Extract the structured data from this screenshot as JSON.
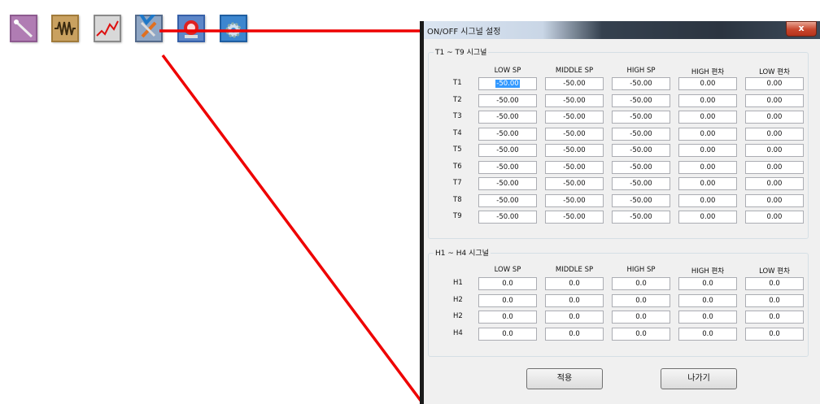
{
  "toolbar": {
    "icons": [
      "wand-icon",
      "resistor-icon",
      "graph-icon",
      "tools-check-icon",
      "alarm-icon",
      "gear-settings-icon"
    ]
  },
  "dialog": {
    "title": "ON/OFF 시그널 설정",
    "close_label": "x",
    "t_group": {
      "label": "T1 ~ T9 시그널",
      "headers": [
        "LOW SP",
        "MIDDLE SP",
        "HIGH SP",
        "HIGH 편차",
        "LOW 편차"
      ],
      "rows": [
        {
          "label": "T1",
          "values": [
            "-50.00",
            "-50.00",
            "-50.00",
            "0.00",
            "0.00"
          ]
        },
        {
          "label": "T2",
          "values": [
            "-50.00",
            "-50.00",
            "-50.00",
            "0.00",
            "0.00"
          ]
        },
        {
          "label": "T3",
          "values": [
            "-50.00",
            "-50.00",
            "-50.00",
            "0.00",
            "0.00"
          ]
        },
        {
          "label": "T4",
          "values": [
            "-50.00",
            "-50.00",
            "-50.00",
            "0.00",
            "0.00"
          ]
        },
        {
          "label": "T5",
          "values": [
            "-50.00",
            "-50.00",
            "-50.00",
            "0.00",
            "0.00"
          ]
        },
        {
          "label": "T6",
          "values": [
            "-50.00",
            "-50.00",
            "-50.00",
            "0.00",
            "0.00"
          ]
        },
        {
          "label": "T7",
          "values": [
            "-50.00",
            "-50.00",
            "-50.00",
            "0.00",
            "0.00"
          ]
        },
        {
          "label": "T8",
          "values": [
            "-50.00",
            "-50.00",
            "-50.00",
            "0.00",
            "0.00"
          ]
        },
        {
          "label": "T9",
          "values": [
            "-50.00",
            "-50.00",
            "-50.00",
            "0.00",
            "0.00"
          ]
        }
      ]
    },
    "h_group": {
      "label": "H1 ~ H4 시그널",
      "headers": [
        "LOW SP",
        "MIDDLE SP",
        "HIGH SP",
        "HIGH 편차",
        "LOW 편차"
      ],
      "rows": [
        {
          "label": "H1",
          "values": [
            "0.0",
            "0.0",
            "0.0",
            "0.0",
            "0.0"
          ]
        },
        {
          "label": "H2",
          "values": [
            "0.0",
            "0.0",
            "0.0",
            "0.0",
            "0.0"
          ]
        },
        {
          "label": "H2",
          "values": [
            "0.0",
            "0.0",
            "0.0",
            "0.0",
            "0.0"
          ]
        },
        {
          "label": "H4",
          "values": [
            "0.0",
            "0.0",
            "0.0",
            "0.0",
            "0.0"
          ]
        }
      ]
    },
    "apply_label": "적용",
    "exit_label": "나가기"
  },
  "colors": {
    "annotation": "#ee0000",
    "dialog_bg": "#f0f0f0",
    "selection": "#3399ff"
  }
}
